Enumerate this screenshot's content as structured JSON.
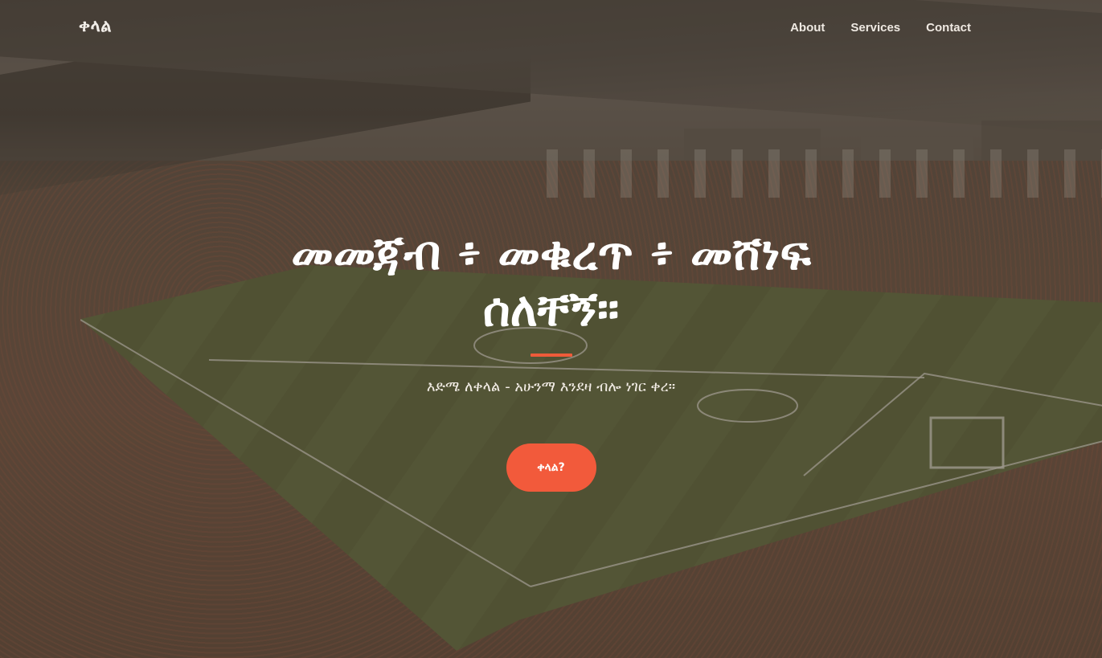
{
  "nav": {
    "brand": "ቀላል",
    "items": [
      {
        "label": "About"
      },
      {
        "label": "Services"
      },
      {
        "label": "Contact"
      }
    ]
  },
  "hero": {
    "title": "መመጃብ ፥ መቁረጥ ፥ መሸነፍ ሰለቸኝ።",
    "subtitle": "እድሜ ለቀላል - አሁንማ እንደዛ ብሎ ነገር ቀረ።",
    "cta_label": "ቀላል?"
  },
  "colors": {
    "accent": "#f25a3b",
    "overlay": "rgba(74,62,50,0.48)",
    "text": "#ffffff"
  }
}
